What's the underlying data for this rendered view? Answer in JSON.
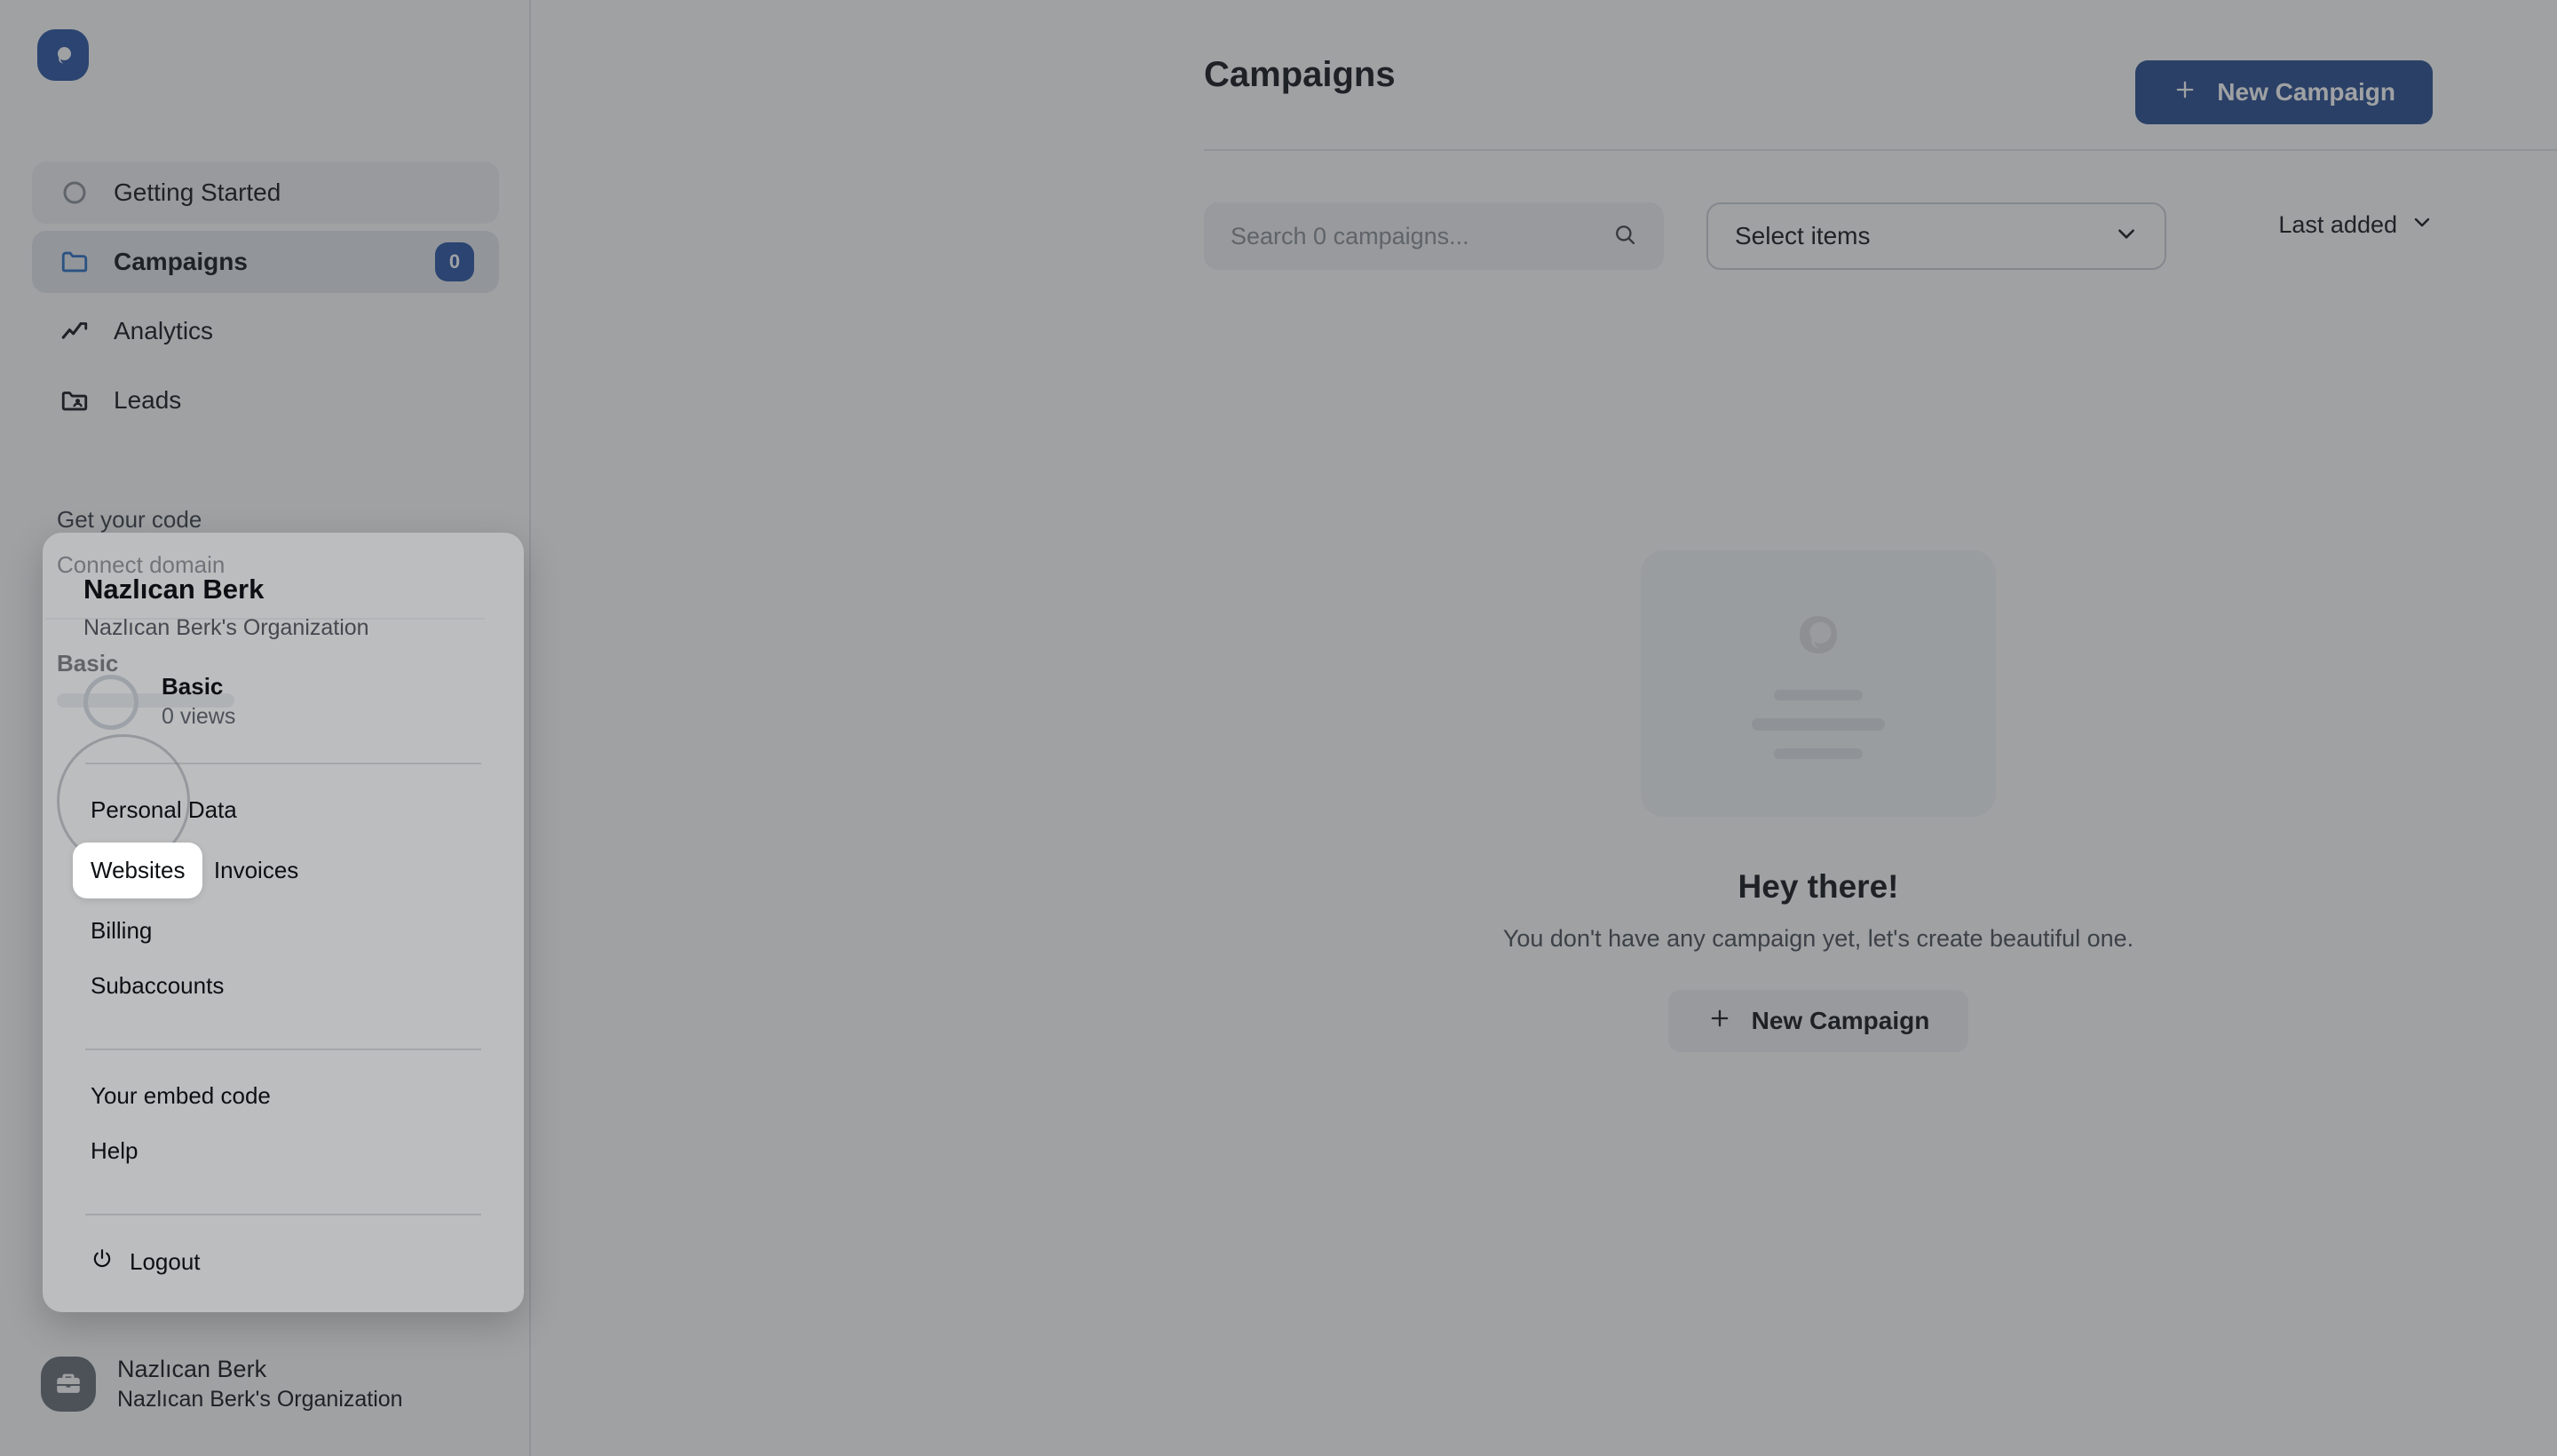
{
  "brand": {
    "logo_icon": "pagesense-logo-icon",
    "accent_color": "#2c57a5"
  },
  "sidebar": {
    "items": [
      {
        "label": "Getting Started",
        "icon": "circle-icon",
        "badge": null
      },
      {
        "label": "Campaigns",
        "icon": "folder-icon",
        "badge": "0"
      },
      {
        "label": "Analytics",
        "icon": "trend-line-icon",
        "badge": null
      },
      {
        "label": "Leads",
        "icon": "folder-user-icon",
        "badge": null
      }
    ],
    "profile": {
      "name": "Nazlıcan Berk",
      "organization": "Nazlıcan Berk's Organization",
      "avatar_icon": "briefcase-icon"
    }
  },
  "header": {
    "title": "Campaigns",
    "new_campaign_label": "New Campaign",
    "plus_icon": "plus-icon"
  },
  "toolbar": {
    "search_placeholder": "Search 0 campaigns...",
    "search_value": "",
    "search_icon": "search-icon",
    "select_label": "Select items",
    "select_chevron": "chevron-down-icon",
    "sort_label": "Last added",
    "sort_chevron": "chevron-down-icon"
  },
  "empty_state": {
    "title": "Hey there!",
    "subtitle": "You don't have any campaign yet, let's create beautiful one.",
    "button_label": "New Campaign",
    "plus_icon": "plus-icon",
    "placeholder_icon": "pagesense-logo-icon"
  },
  "account_menu": {
    "name": "Nazlıcan Berk",
    "organization": "Nazlıcan Berk's Organization",
    "plan": {
      "name": "Basic",
      "views": "0 views",
      "ring_icon": "progress-ring-icon"
    },
    "group1": [
      {
        "label": "Personal Data",
        "highlighted": false
      },
      {
        "label": "Websites",
        "highlighted": true
      },
      {
        "label": "Invoices",
        "highlighted": false
      },
      {
        "label": "Billing",
        "highlighted": false
      },
      {
        "label": "Subaccounts",
        "highlighted": false
      }
    ],
    "group2": [
      {
        "label": "Your embed code",
        "highlighted": false
      },
      {
        "label": "Help",
        "highlighted": false
      }
    ],
    "logout": {
      "label": "Logout",
      "icon": "power-icon"
    }
  }
}
